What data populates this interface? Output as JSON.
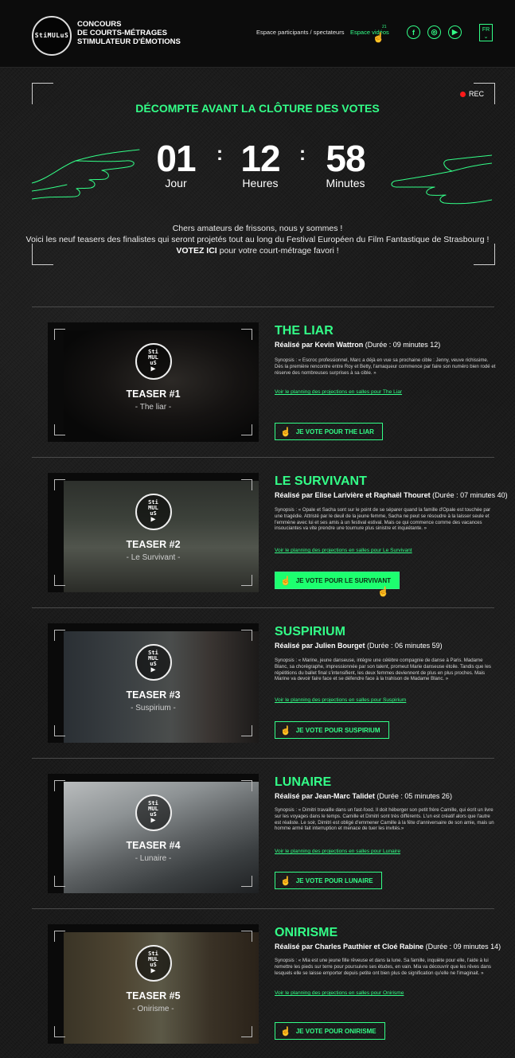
{
  "brand": {
    "logo_lines": [
      "Sti",
      "MUL",
      "uS"
    ],
    "line1": "CONCOURS",
    "line2": "DE COURTS-MÉTRAGES",
    "line3": "STIMULATEUR D'ÉMOTIONS"
  },
  "nav": {
    "participants": "Espace participants / spectateurs",
    "videos": "Espace vidéos",
    "videos_badge": "21",
    "social_icons": [
      "facebook-icon",
      "instagram-icon",
      "youtube-icon"
    ],
    "lang": "FR",
    "lang_chevron": "⌄"
  },
  "countdown": {
    "rec": "REC",
    "title": "DÉCOMPTE AVANT LA CLÔTURE DES VOTES",
    "days": "01",
    "days_label": "Jour",
    "hours": "12",
    "hours_label": "Heures",
    "minutes": "58",
    "minutes_label": "Minutes",
    "sep": ":"
  },
  "intro": {
    "line1": "Chers amateurs de frissons, nous y sommes !",
    "line2": "Voici les neuf teasers des finalistes qui seront projetés tout au long du Festival Européen du Film Fantastique de Strasbourg !",
    "vote_here": "VOTEZ ICI",
    "line3_rest": " pour votre court-métrage favori !"
  },
  "teasers": [
    {
      "label": "TEASER #1",
      "sub": "- The liar -",
      "title": "THE LIAR",
      "director_label": "Réalisé par Kevin Wattron",
      "duration": " (Durée : 09 minutes 12)",
      "synopsis": "Synopsis : « Escroc professionnel, Marc a déjà en vue sa prochaine cible : Jenny, veuve richissime. Dès la première rencontre entre Roy et Betty, l'arnaqueur commence par faire son numéro bien rodé et réserve des nombreuses surprises à sa cible. »",
      "link": "Voir le planning des projections en salles pour The Liar",
      "vote": "JE VOTE POUR THE LIAR"
    },
    {
      "label": "TEASER #2",
      "sub": "- Le Survivant -",
      "title": "LE SURVIVANT",
      "director_label": "Réalisé par Elise Larivière et Raphaël Thouret",
      "duration": " (Durée : 07 minutes 40)",
      "synopsis": "Synopsis : « Opale et Sacha sont sur le point de se séparer quand la famille d'Opale est touchée par une tragédie. Attristé par le deuil de la jeune femme, Sacha ne peut se résoudre à la laisser seule et l'emmène avec lui et ses amis à un festival estival. Mais ce qui commence comme des vacances insouciantes va vite prendre une tournure plus sinistre et inquiétante. »",
      "link": "Voir le planning des projections en salles pour Le Survivant",
      "vote": "JE VOTE POUR LE SURVIVANT"
    },
    {
      "label": "TEASER #3",
      "sub": "- Suspirium -",
      "title": "SUSPIRIUM",
      "director_label": "Réalisé par Julien Bourget",
      "duration": " (Durée : 06 minutes 59)",
      "synopsis": "Synopsis : « Marine, jeune danseuse, intègre une célèbre compagnie de danse à Paris. Madame Blanc, sa chorégraphe, impressionnée par son talent, promeut Marie danseuse étoile. Tandis que les répétitions du ballet final s'intensifient, les deux femmes deviennent de plus en plus proches. Mais Marine va devoir faire face et se défendre face à la trahison de Madame Blanc. »",
      "link": "Voir le planning des projections en salles pour Suspirium",
      "vote": "JE VOTE POUR SUSPIRIUM"
    },
    {
      "label": "TEASER #4",
      "sub": "- Lunaire -",
      "title": "LUNAIRE",
      "director_label": "Réalisé par Jean-Marc Talidet",
      "duration": " (Durée : 05 minutes 26)",
      "synopsis": "Synopsis : « Dimitri travaille dans un fast-food. Il doit héberger son petit frère Camille, qui écrit un livre sur les voyages dans le temps. Camille et Dimitri sont très différents. L'un est créatif alors que l'autre est réaliste. Le soir, Dimitri est obligé d'emmener Camille à la fête d'anniversaire de son amie, mais un homme armé fait interruption et menace de tuer les invités.»",
      "link": "Voir le planning des projections en salles pour Lunaire",
      "vote": "JE VOTE POUR LUNAIRE"
    },
    {
      "label": "TEASER #5",
      "sub": "- Onirisme -",
      "title": "ONIRISME",
      "director_label": "Réalisé par Charles Pauthier et Cloé Rabine",
      "duration": " (Durée : 09 minutes 14)",
      "synopsis": "Synopsis : « Mia est une jeune fille rêveuse et dans la lune. Sa famille, inquiète pour elle, l'aide à lui remettre les pieds sur terre pour poursuivre ses études, en vain. Mia va découvrir que les rêves dans lesquels elle se laisse emporter depuis petite ont bien plus de signification qu'elle ne l'imaginait. »",
      "link": "Voir le planning des projections en salles pour Onirisme",
      "vote": "JE VOTE POUR ONIRISME"
    }
  ],
  "colors": {
    "accent": "#33ff88",
    "rec": "#ff1a1a",
    "background": "#1a1a1a"
  }
}
